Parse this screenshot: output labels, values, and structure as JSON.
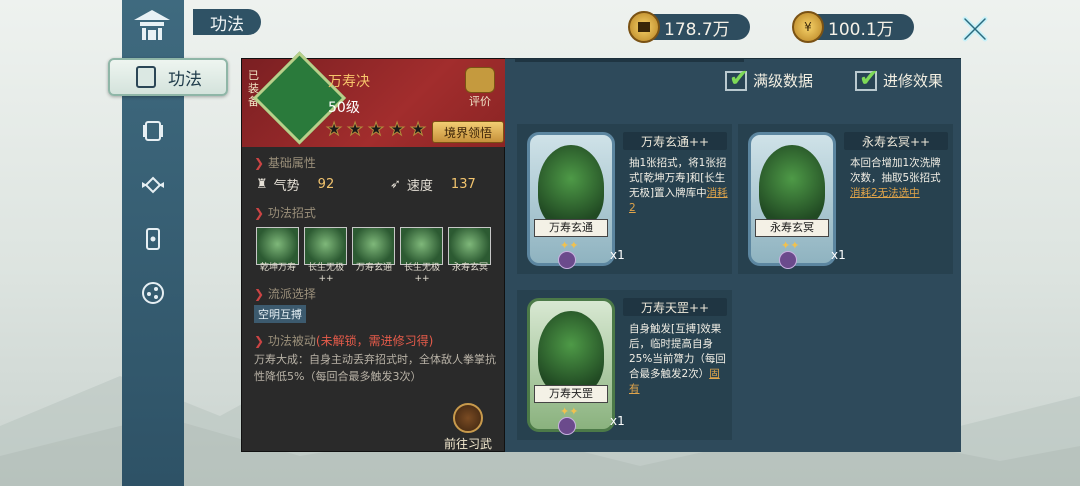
{
  "header": {
    "title": "功法"
  },
  "sidebar": {
    "active_tab": "功法"
  },
  "currency": [
    {
      "value": "178.7万"
    },
    {
      "value": "100.1万"
    }
  ],
  "skill": {
    "equipped_label": "已装备",
    "name": "万寿决",
    "level": "50级",
    "stars_total": 5,
    "realm_button": "境界领悟",
    "rate_label": "评价"
  },
  "attributes": {
    "title": "基础属性",
    "momentum_label": "气势",
    "momentum_value": "92",
    "speed_label": "速度",
    "speed_value": "137"
  },
  "moves": {
    "title": "功法招式",
    "items": [
      "乾坤万寿",
      "长生无极",
      "万寿玄通",
      "长生无极",
      "永寿玄冥"
    ],
    "plus": [
      "",
      "++",
      "",
      "++",
      ""
    ]
  },
  "school": {
    "title": "流派选择",
    "tag": "空明互搏"
  },
  "passive": {
    "title": "功法被动",
    "warning": "(未解锁，需进修习得)",
    "text": "万寿大成：自身主动丢弃招式时，全体敌人拳掌抗性降低5%（每回合最多触发3次）"
  },
  "goto_button": "前往习武",
  "options": {
    "max_data": "满级数据",
    "advanced_effect": "进修效果"
  },
  "cards": [
    {
      "title": "万寿玄通++",
      "art_name": "万寿玄通",
      "count": "x1",
      "desc": "抽1张招式，将1张招式[乾坤万寿]和[长生无极]置入牌库中",
      "link": "消耗2"
    },
    {
      "title": "永寿玄冥++",
      "art_name": "永寿玄冥",
      "count": "x1",
      "desc": "本回合增加1次洗牌次数，抽取5张招式",
      "link": "消耗2无法选中"
    },
    {
      "title": "万寿天罡++",
      "art_name": "万寿天罡",
      "count": "x1",
      "desc": "自身触发[互搏]效果后，临时提高自身25%当前膂力（每回合最多触发2次）",
      "link": "固有"
    }
  ]
}
